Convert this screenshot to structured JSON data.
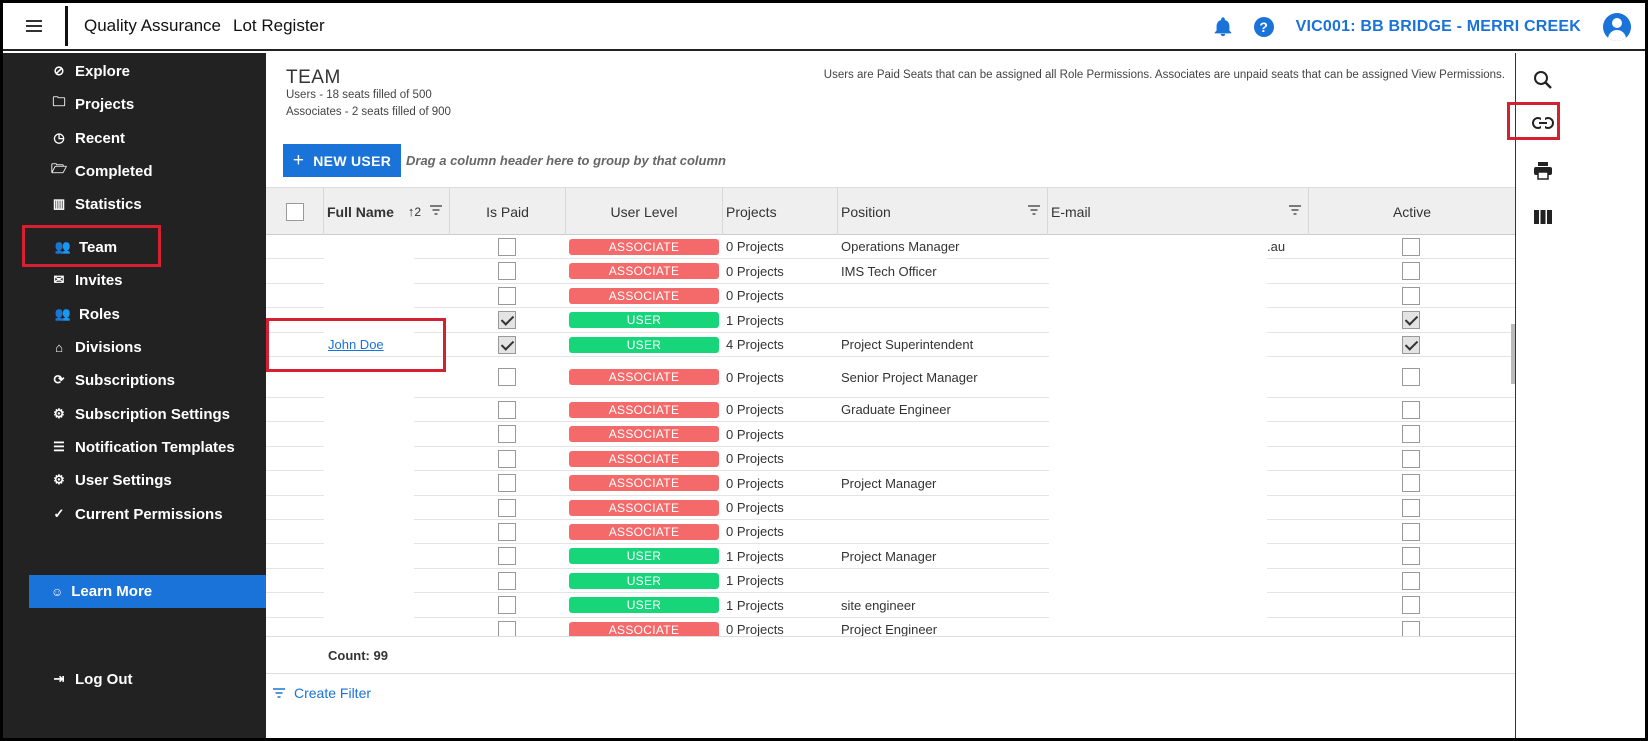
{
  "header": {
    "app_title": "Quality Assurance",
    "app_subtitle": "Lot Register",
    "project": "VIC001: BB BRIDGE - MERRI CREEK",
    "help_label": "?"
  },
  "sidebar": {
    "items": [
      {
        "label": "Explore",
        "icon": "compass-icon"
      },
      {
        "label": "Projects",
        "icon": "folder-icon"
      },
      {
        "label": "Recent",
        "icon": "clock-icon"
      },
      {
        "label": "Completed",
        "icon": "folder-check-icon"
      },
      {
        "label": "Statistics",
        "icon": "chart-icon"
      },
      {
        "label": "Team",
        "icon": "people-icon"
      },
      {
        "label": "Invites",
        "icon": "envelope-icon"
      },
      {
        "label": "Roles",
        "icon": "people-icon"
      },
      {
        "label": "Divisions",
        "icon": "home-icon"
      },
      {
        "label": "Subscriptions",
        "icon": "refresh-icon"
      },
      {
        "label": "Subscription Settings",
        "icon": "gear-icon"
      },
      {
        "label": "Notification Templates",
        "icon": "list-icon"
      },
      {
        "label": "User Settings",
        "icon": "gear-icon"
      },
      {
        "label": "Current Permissions",
        "icon": "check-icon"
      }
    ],
    "learn_more": "Learn More",
    "logout": "Log Out"
  },
  "team": {
    "title": "TEAM",
    "users_seats": "Users - 18 seats filled of 500",
    "associates_seats": "Associates - 2 seats filled of 900",
    "notice": "Users are Paid Seats that can be assigned all Role Permissions. Associates are unpaid seats that can be assigned View Permissions.",
    "new_user": "NEW USER",
    "group_hint": "Drag a column header here to group by that column"
  },
  "grid": {
    "columns": {
      "full_name": "Full Name",
      "sort_index": "2",
      "is_paid": "Is Paid",
      "user_level": "User Level",
      "projects": "Projects",
      "position": "Position",
      "email": "E-mail",
      "active": "Active"
    },
    "rows": [
      {
        "name": "",
        "paid": false,
        "level": "ASSOCIATE",
        "projects": "0 Projects",
        "position": "Operations Manager",
        "email": ".au",
        "active": false
      },
      {
        "name": "",
        "paid": false,
        "level": "ASSOCIATE",
        "projects": "0 Projects",
        "position": "IMS Tech Officer",
        "email": "",
        "active": false
      },
      {
        "name": "",
        "paid": false,
        "level": "ASSOCIATE",
        "projects": "0 Projects",
        "position": "",
        "email": "",
        "active": false
      },
      {
        "name": "",
        "paid": true,
        "level": "USER",
        "projects": "1 Projects",
        "position": "",
        "email": "",
        "active": true
      },
      {
        "name": "John Doe",
        "paid": true,
        "level": "USER",
        "projects": "4 Projects",
        "position": "Project Superintendent",
        "email": "",
        "active": true
      },
      {
        "name": "",
        "paid": false,
        "level": "ASSOCIATE",
        "projects": "0 Projects",
        "position": "Senior Project Manager",
        "email": "",
        "active": false
      },
      {
        "name": "",
        "paid": false,
        "level": "ASSOCIATE",
        "projects": "0 Projects",
        "position": "Graduate Engineer",
        "email": "",
        "active": false
      },
      {
        "name": "",
        "paid": false,
        "level": "ASSOCIATE",
        "projects": "0 Projects",
        "position": "",
        "email": "",
        "active": false
      },
      {
        "name": "",
        "paid": false,
        "level": "ASSOCIATE",
        "projects": "0 Projects",
        "position": "",
        "email": "",
        "active": false
      },
      {
        "name": "",
        "paid": false,
        "level": "ASSOCIATE",
        "projects": "0 Projects",
        "position": "Project Manager",
        "email": "",
        "active": false
      },
      {
        "name": "",
        "paid": false,
        "level": "ASSOCIATE",
        "projects": "0 Projects",
        "position": "",
        "email": "",
        "active": false
      },
      {
        "name": "",
        "paid": false,
        "level": "ASSOCIATE",
        "projects": "0 Projects",
        "position": "",
        "email": "",
        "active": false
      },
      {
        "name": "",
        "paid": false,
        "level": "USER",
        "projects": "1 Projects",
        "position": "Project Manager",
        "email": "",
        "active": false
      },
      {
        "name": "",
        "paid": false,
        "level": "USER",
        "projects": "1 Projects",
        "position": "",
        "email": "",
        "active": false
      },
      {
        "name": "",
        "paid": false,
        "level": "USER",
        "projects": "1 Projects",
        "position": "site engineer",
        "email": "",
        "active": false
      },
      {
        "name": "",
        "paid": false,
        "level": "ASSOCIATE",
        "projects": "0 Projects",
        "position": "Project Engineer",
        "email": "",
        "active": false
      }
    ],
    "count": "Count: 99",
    "create_filter": "Create Filter"
  },
  "colors": {
    "accent": "#1a73d9",
    "associate": "#f46a6a",
    "user": "#17d67a",
    "sidebar_bg": "#222222",
    "highlight": "#d42030"
  },
  "rail": [
    "search-icon",
    "link-icon",
    "print-icon",
    "columns-icon"
  ]
}
